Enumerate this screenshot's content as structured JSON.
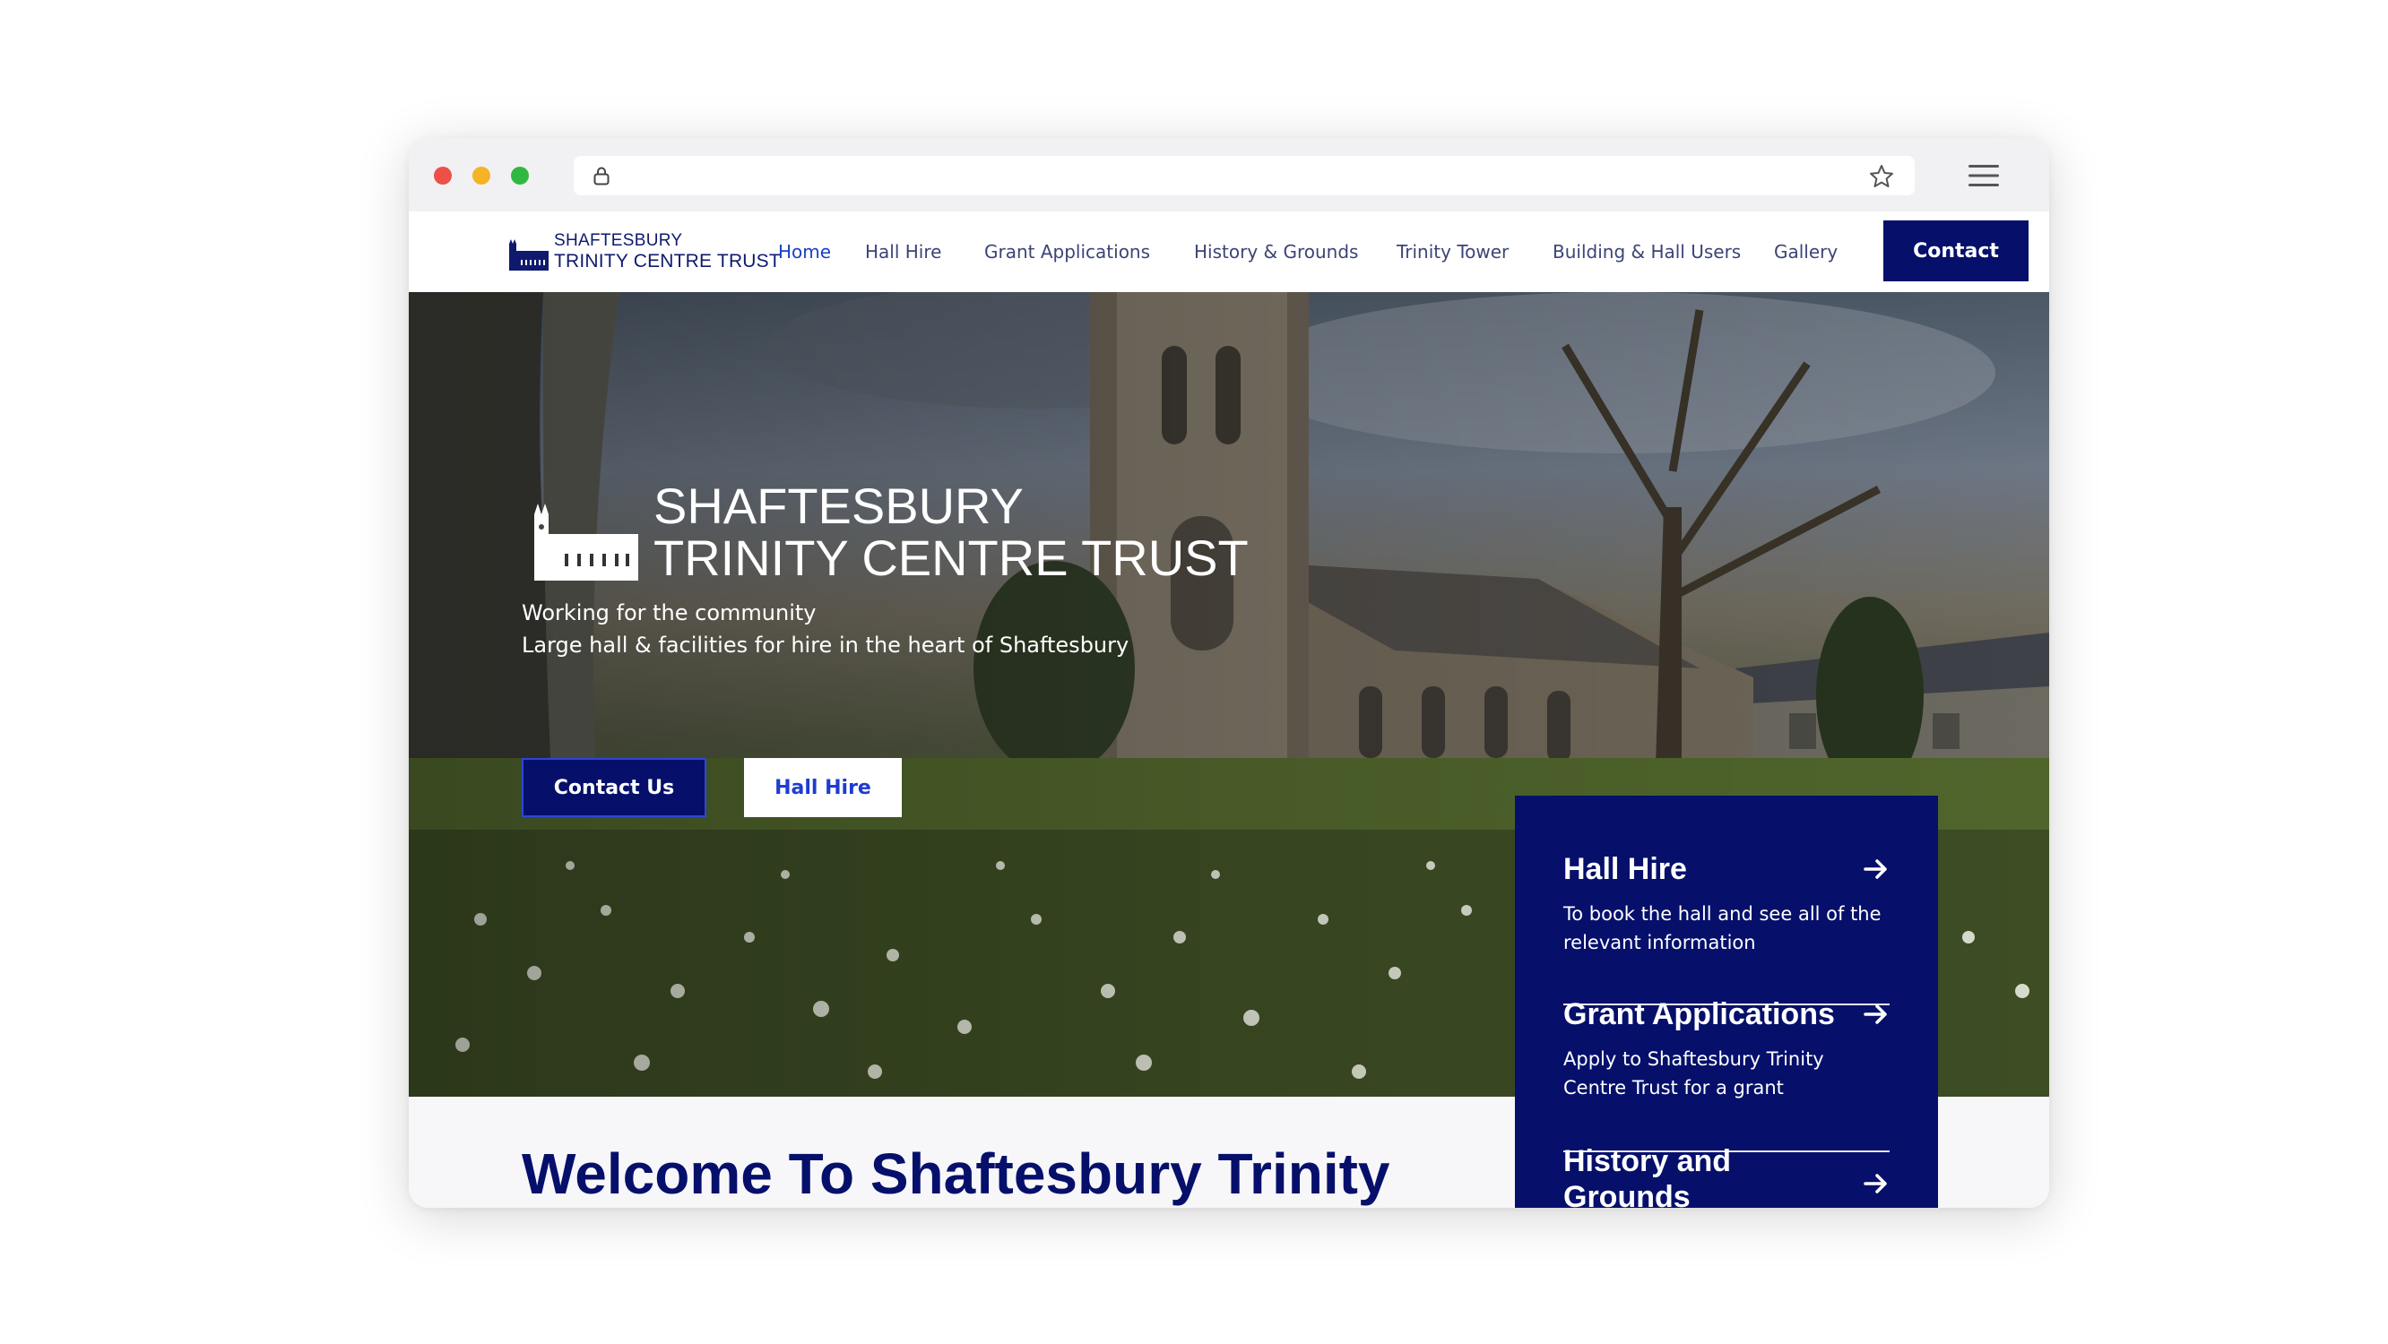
{
  "site": {
    "logo_line1": "SHAFTESBURY",
    "logo_line2": "TRINITY CENTRE TRUST"
  },
  "nav": {
    "items": [
      {
        "label": "Home",
        "active": true
      },
      {
        "label": "Hall Hire"
      },
      {
        "label": "Grant Applications"
      },
      {
        "label": "History & Grounds"
      },
      {
        "label": "Trinity Tower"
      },
      {
        "label": "Building & Hall Users"
      },
      {
        "label": "Gallery"
      }
    ],
    "contact_label": "Contact"
  },
  "hero": {
    "title_line1": "SHAFTESBURY",
    "title_line2": "TRINITY CENTRE TRUST",
    "sub_line1": "Working for the community",
    "sub_line2": "Large hall & facilities for hire in the heart of Shaftesbury",
    "contact_us_label": "Contact Us",
    "hall_hire_label": "Hall Hire"
  },
  "panel": {
    "items": [
      {
        "title": "Hall Hire",
        "desc": "To book the hall and see all of the relevant information"
      },
      {
        "title": "Grant Applications",
        "desc": "Apply to Shaftesbury Trinity Centre Trust for a grant"
      },
      {
        "title": "History and Grounds",
        "desc": ""
      }
    ]
  },
  "welcome": "Welcome To Shaftesbury Trinity",
  "colors": {
    "brand_navy": "#06106b",
    "link_active": "#1740c9"
  },
  "icons": [
    "lock-icon",
    "star-icon",
    "menu-icon",
    "church-logo-icon",
    "arrow-right-icon"
  ]
}
